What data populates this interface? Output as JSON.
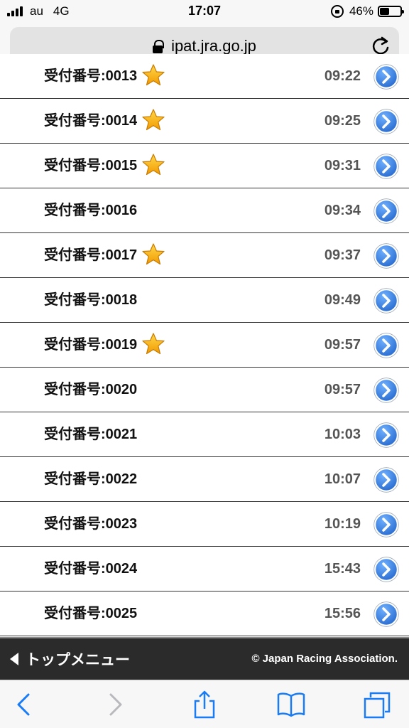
{
  "status_bar": {
    "carrier": "au",
    "network": "4G",
    "time": "17:07",
    "battery": "46%",
    "battery_level": 0.46
  },
  "browser": {
    "url": "ipat.jra.go.jp"
  },
  "list": {
    "partial_top": {
      "label": "受付番号:0013",
      "time": "09:22",
      "starred": true
    },
    "rows": [
      {
        "label": "受付番号:0014",
        "time": "09:25",
        "starred": true
      },
      {
        "label": "受付番号:0015",
        "time": "09:31",
        "starred": true
      },
      {
        "label": "受付番号:0016",
        "time": "09:34",
        "starred": false
      },
      {
        "label": "受付番号:0017",
        "time": "09:37",
        "starred": true
      },
      {
        "label": "受付番号:0018",
        "time": "09:49",
        "starred": false
      },
      {
        "label": "受付番号:0019",
        "time": "09:57",
        "starred": true
      },
      {
        "label": "受付番号:0020",
        "time": "09:57",
        "starred": false
      },
      {
        "label": "受付番号:0021",
        "time": "10:03",
        "starred": false
      },
      {
        "label": "受付番号:0022",
        "time": "10:07",
        "starred": false
      },
      {
        "label": "受付番号:0023",
        "time": "10:19",
        "starred": false
      },
      {
        "label": "受付番号:0024",
        "time": "15:43",
        "starred": false
      },
      {
        "label": "受付番号:0025",
        "time": "15:56",
        "starred": false
      }
    ]
  },
  "footer": {
    "top_menu_label": "トップメニュー",
    "copyright": "© Japan Racing Association."
  },
  "toolbar": {
    "icons": [
      "back-icon",
      "forward-icon",
      "share-icon",
      "bookmarks-icon",
      "tabs-icon"
    ]
  },
  "colors": {
    "accent_blue": "#2f7bd8",
    "star_gold": "#f7b500",
    "footer_bg": "#2b2b2b",
    "ios_blue": "#1a7cf5"
  }
}
